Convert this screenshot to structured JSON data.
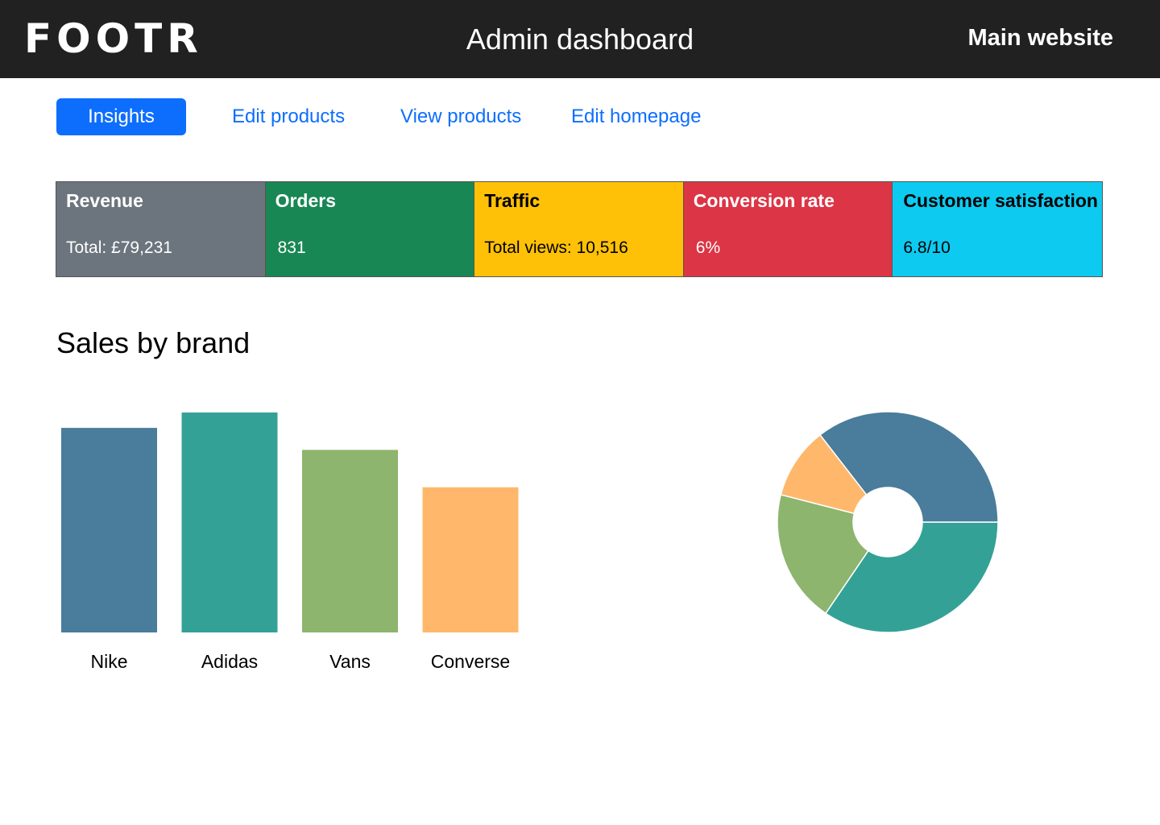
{
  "header": {
    "logo": "FOOTR",
    "title": "Admin dashboard",
    "main_link": "Main website"
  },
  "tabs": [
    {
      "label": "Insights",
      "active": true
    },
    {
      "label": "Edit products",
      "active": false
    },
    {
      "label": "View products",
      "active": false
    },
    {
      "label": "Edit homepage",
      "active": false
    }
  ],
  "stats": [
    {
      "label": "Revenue",
      "value": "Total: £79,231",
      "bg": "#6c757d",
      "fg": "#ffffff"
    },
    {
      "label": "Orders",
      "value": "831",
      "bg": "#198754",
      "fg": "#ffffff"
    },
    {
      "label": "Traffic",
      "value": "Total views: 10,516",
      "bg": "#ffc107",
      "fg": "#000000"
    },
    {
      "label": "Conversion rate",
      "value": "6%",
      "bg": "#dc3545",
      "fg": "#ffffff"
    },
    {
      "label": "Customer satisfaction",
      "value": "6.8/10",
      "bg": "#0dcaf0",
      "fg": "#000000"
    }
  ],
  "section_title": "Sales by brand",
  "chart_data": [
    {
      "type": "bar",
      "categories": [
        "Nike",
        "Adidas",
        "Vans",
        "Converse"
      ],
      "values": [
        93,
        100,
        83,
        66
      ],
      "colors": [
        "#4a7c9b",
        "#34a196",
        "#8db56d",
        "#ffb86b"
      ],
      "ylim": [
        0,
        100
      ],
      "grid": false
    },
    {
      "type": "pie",
      "donut": true,
      "categories": [
        "Adidas",
        "Vans",
        "Converse",
        "Nike"
      ],
      "values": [
        34.5,
        19.5,
        10.5,
        35.5
      ],
      "colors": [
        "#34a196",
        "#8db56d",
        "#ffb86b",
        "#4a7c9b"
      ]
    }
  ]
}
